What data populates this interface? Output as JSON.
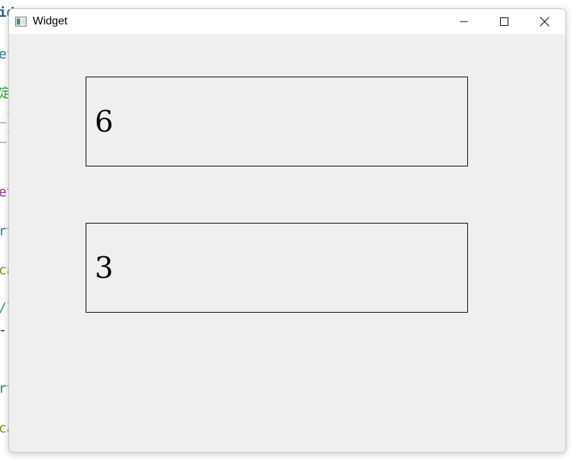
{
  "background_editor": {
    "fragments": [
      {
        "text": "id",
        "color": "#1b5c8a"
      },
      {
        "text": "et",
        "color": "#1b7f8f"
      },
      {
        "text": "定",
        "color": "#3a9a3a"
      },
      {
        "text": "_f",
        "color": "#b0302a"
      },
      {
        "text": "_f",
        "color": "#b0302a"
      },
      {
        "text": "et",
        "color": "#8a2f8a"
      },
      {
        "text": "rt",
        "color": "#1b7f8f"
      },
      {
        "text": "ca",
        "color": "#8a8a2a"
      },
      {
        "text": "/l",
        "color": "#2a9a6a"
      },
      {
        "text": "-",
        "color": "#222222"
      },
      {
        "text": "rt",
        "color": "#1b7f8f"
      },
      {
        "text": "ca",
        "color": "#8a8a2a"
      }
    ]
  },
  "window": {
    "title": "Widget",
    "icon": "app-window-icon",
    "controls": {
      "minimize_icon": "minimize-icon",
      "maximize_icon": "maximize-icon",
      "close_icon": "close-icon"
    }
  },
  "content": {
    "box1_value": "6",
    "box2_value": "3"
  },
  "colors": {
    "window_background": "#efefef",
    "titlebar_background": "#ffffff",
    "box_border": "#000000"
  }
}
